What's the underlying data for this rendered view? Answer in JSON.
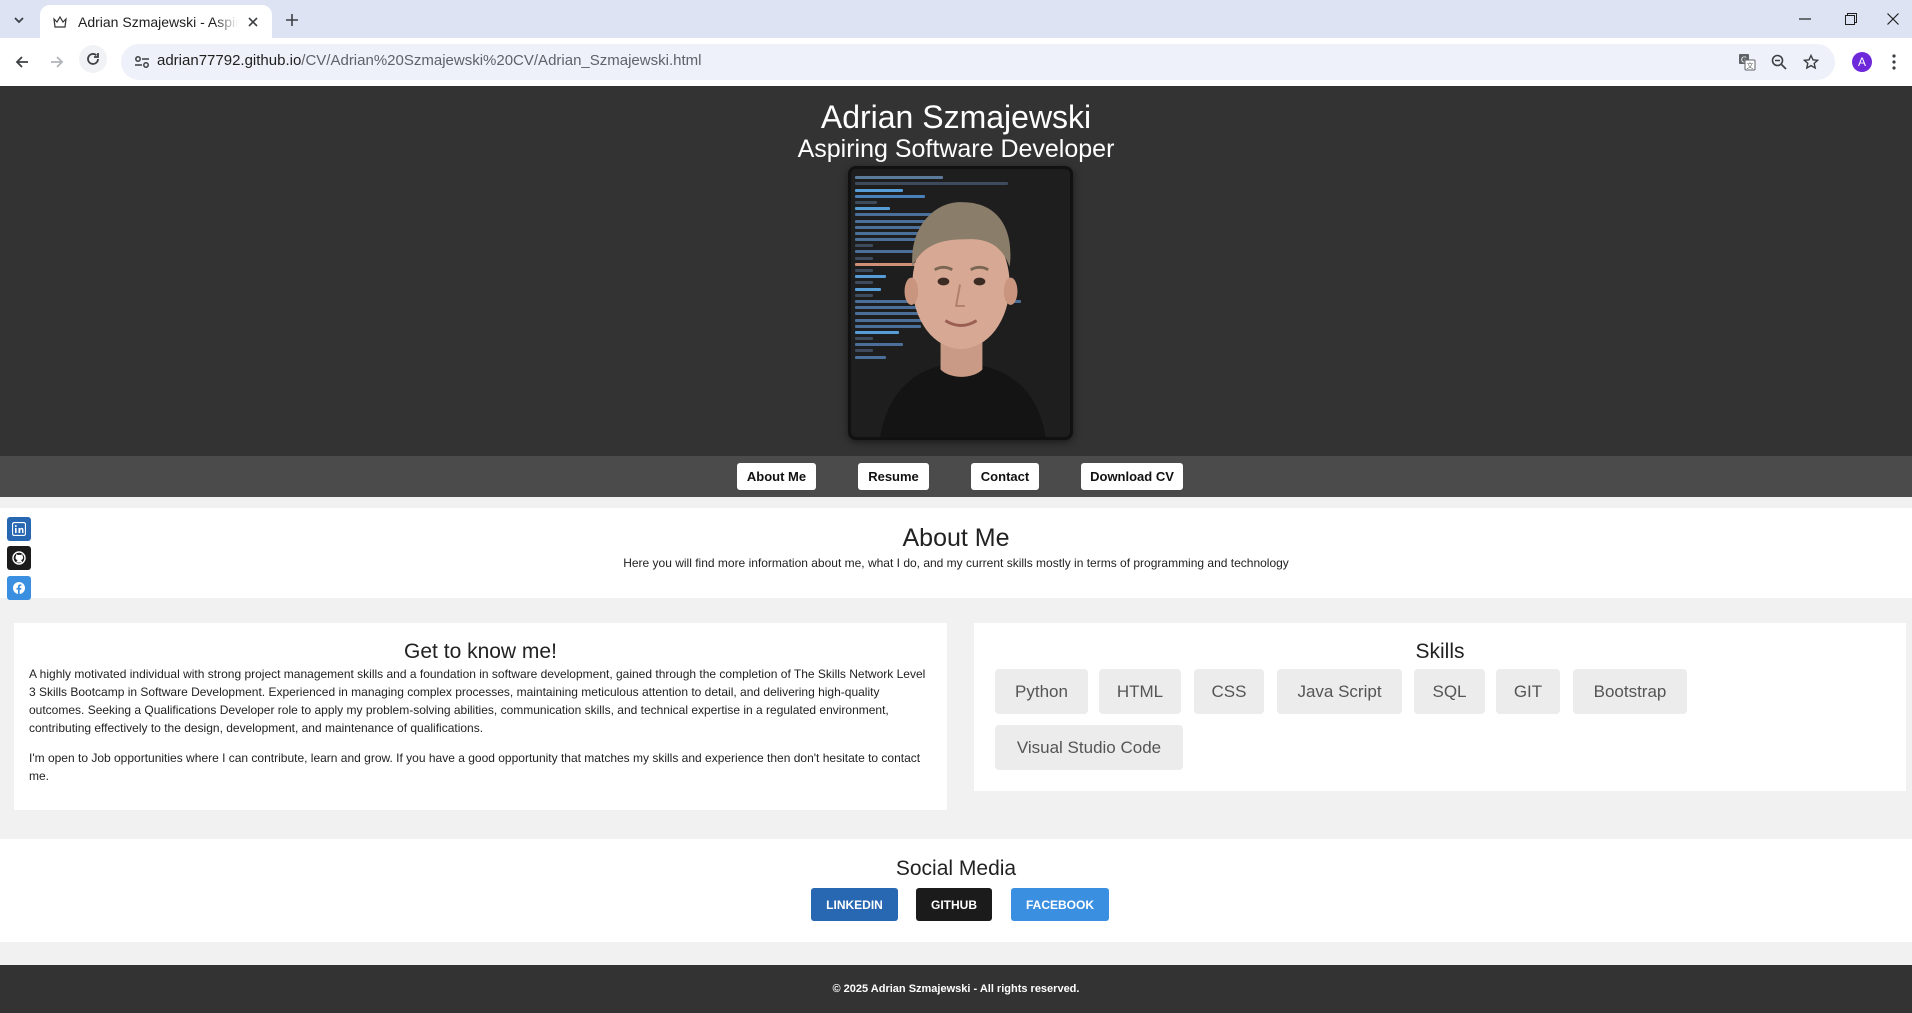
{
  "browser": {
    "tab_title": "Adrian Szmajewski - Aspiring Software Developer",
    "url_host": "adrian77792.github.io",
    "url_path": "/CV/Adrian%20Szmajewski%20CV/Adrian_Szmajewski.html",
    "profile_initial": "A"
  },
  "header": {
    "name": "Adrian Szmajewski",
    "role": "Aspiring Software Developer"
  },
  "nav": {
    "about": "About Me",
    "resume": "Resume",
    "contact": "Contact",
    "download": "Download CV"
  },
  "about": {
    "title": "About Me",
    "subtitle": "Here you will find more information about me, what I do, and my current skills mostly in terms of programming and technology"
  },
  "intro": {
    "title": "Get to know me!",
    "paragraph1": "A highly motivated individual with strong project management skills and a foundation in software development, gained through the completion of The Skills Network Level 3 Skills Bootcamp in Software Development. Experienced in managing complex processes, maintaining meticulous attention to detail, and delivering high-quality outcomes. Seeking a Qualifications Developer role to apply my problem-solving abilities, communication skills, and technical expertise in a regulated environment, contributing effectively to the design, development, and maintenance of qualifications.",
    "paragraph2": "I'm open to Job opportunities where I can contribute, learn and grow. If you have a good opportunity that matches my skills and experience then don't hesitate to contact me."
  },
  "skills": {
    "title": "Skills",
    "items": [
      "Python",
      "HTML",
      "CSS",
      "Java Script",
      "SQL",
      "GIT",
      "Bootstrap",
      "Visual Studio Code"
    ]
  },
  "social": {
    "title": "Social Media",
    "linkedin": "LINKEDIN",
    "github": "GITHUB",
    "facebook": "FACEBOOK"
  },
  "footer": {
    "text": "© 2025 Adrian Szmajewski - All rights reserved."
  },
  "colors": {
    "header_bg": "#333333",
    "navbar_bg": "#4b4b4b",
    "linkedin": "#2867b2",
    "github": "#1b1b1b",
    "facebook": "#3b8fe0"
  },
  "icons": {
    "floating": [
      "linkedin-icon",
      "github-icon",
      "facebook-icon"
    ]
  }
}
